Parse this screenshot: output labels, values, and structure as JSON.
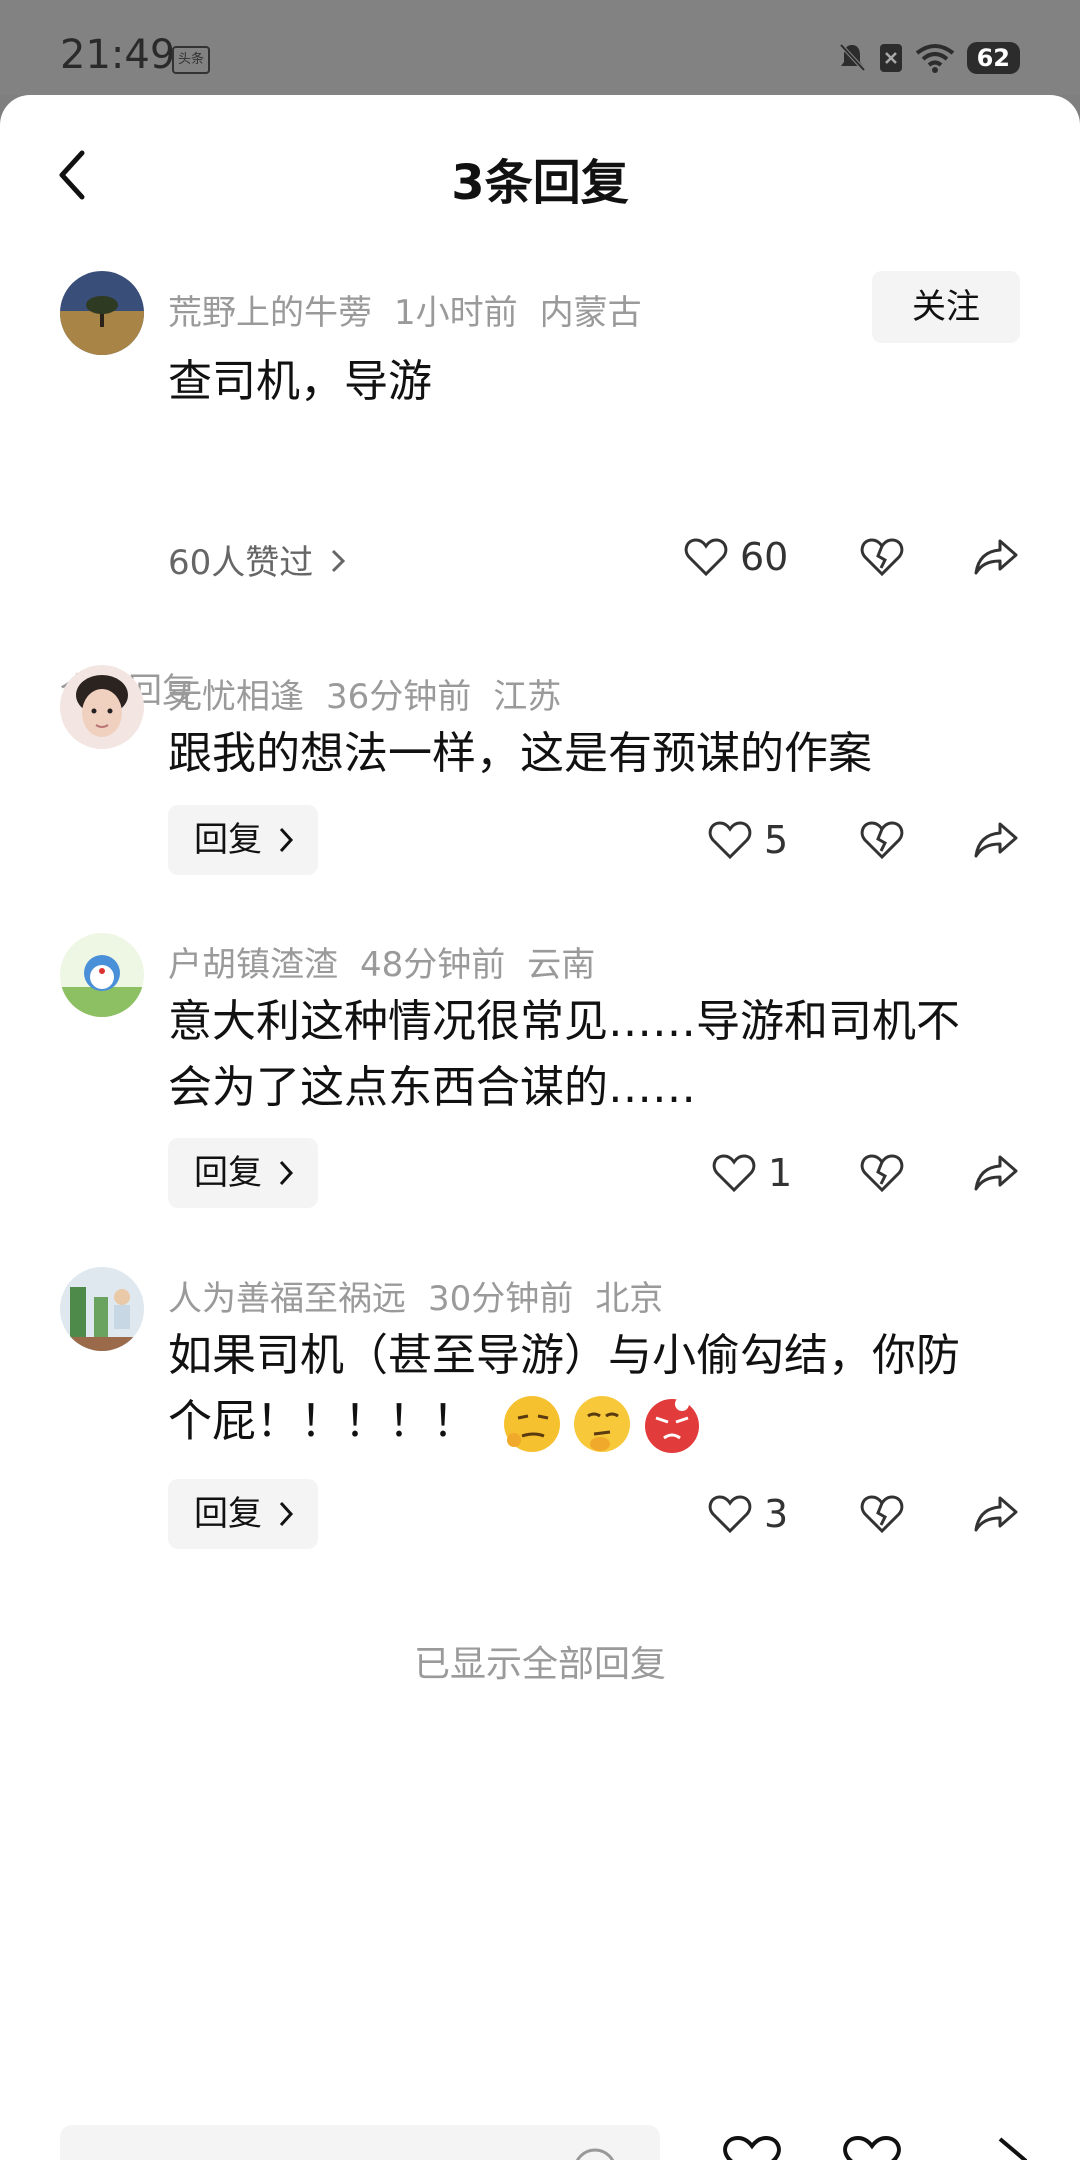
{
  "status_bar": {
    "time": "21:49",
    "app_badge": "头条",
    "battery": "62"
  },
  "header": {
    "title": "3条回复"
  },
  "main_comment": {
    "username": "荒野上的牛蒡",
    "time": "1小时前",
    "location": "内蒙古",
    "follow_label": "关注",
    "text": "查司机，导游",
    "liked_by": "60人赞过",
    "likes": "60"
  },
  "section_label": "全部回复",
  "replies": [
    {
      "username": "无忧相逢",
      "time": "36分钟前",
      "location": "江苏",
      "text": "跟我的想法一样，这是有预谋的作案",
      "reply_label": "回复",
      "likes": "5"
    },
    {
      "username": "户胡镇渣渣",
      "time": "48分钟前",
      "location": "云南",
      "text": "意大利这种情况很常见……导游和司机不会为了这点东西合谋的……",
      "reply_label": "回复",
      "likes": "1"
    },
    {
      "username": "人为善福至祸远",
      "time": "30分钟前",
      "location": "北京",
      "text": "如果司机（甚至导游）与小偷勾结，你防个屁！！！！！",
      "reply_label": "回复",
      "likes": "3"
    }
  ],
  "end_text": "已显示全部回复",
  "colors": {
    "meta_gray": "#9a9a9a",
    "button_bg": "#f4f4f4"
  }
}
